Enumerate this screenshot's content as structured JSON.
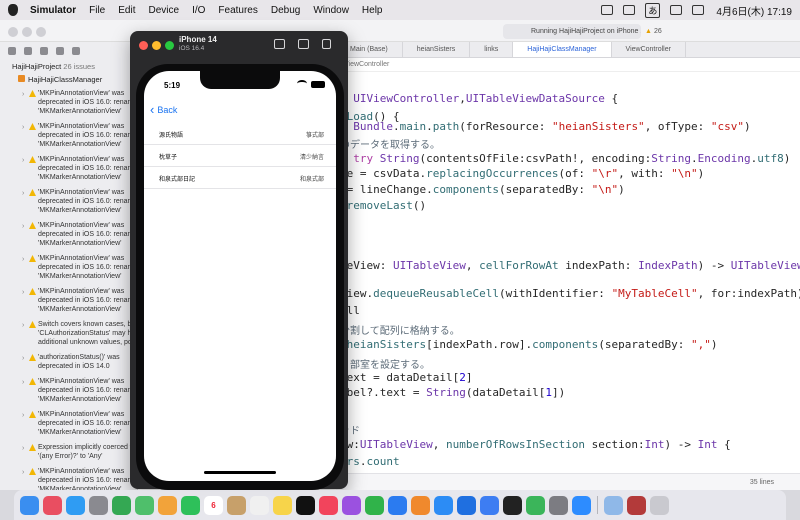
{
  "menubar": {
    "items": [
      "Simulator",
      "File",
      "Edit",
      "Device",
      "I/O",
      "Features",
      "Debug",
      "Window",
      "Help"
    ],
    "input_badge": "あ",
    "clock": "4月6日(木) 17:19"
  },
  "xcode": {
    "tabs": [
      {
        "label": "Main (Base)",
        "active": false
      },
      {
        "label": "heianSisters",
        "active": false
      },
      {
        "label": "links",
        "active": false
      },
      {
        "label": "HajiHajiClassManager",
        "active": true
      },
      {
        "label": "ViewController",
        "active": false
      }
    ],
    "breadcrumb": "ViewController",
    "run_status": "Running HajiHajiProject on iPhone 14",
    "warning_count": "26",
    "status_line": "35 lines",
    "navigator": {
      "project": "HajiHajiProject",
      "project_count": "26 issues",
      "file": "HajiHajiClassManager",
      "issues": [
        "'MKPinAnnotationView' was\ndeprecated in iOS 16.0: renam\n'MKMarkerAnnotationView'",
        "'MKPinAnnotationView' was\ndeprecated in iOS 16.0: renam\n'MKMarkerAnnotationView'",
        "'MKPinAnnotationView' was\ndeprecated in iOS 16.0: renam\n'MKMarkerAnnotationView'",
        "'MKPinAnnotationView' was\ndeprecated in iOS 16.0: renam\n'MKMarkerAnnotationView'",
        "'MKPinAnnotationView' was\ndeprecated in iOS 16.0: renam\n'MKMarkerAnnotationView'",
        "'MKPinAnnotationView' was\ndeprecated in iOS 16.0: renam\n'MKMarkerAnnotationView'",
        "'MKPinAnnotationView' was\ndeprecated in iOS 16.0: renam\n'MKMarkerAnnotationView'",
        "Switch covers known cases, b\n'CLAuthorizationStatus' may h\nadditional unknown values, po",
        "'authorizationStatus()' was\ndeprecated in iOS 14.0",
        "'MKPinAnnotationView' was\ndeprecated in iOS 16.0: renam\n'MKMarkerAnnotationView'",
        "'MKPinAnnotationView' was\ndeprecated in iOS 16.0: renam\n'MKMarkerAnnotationView'",
        "Expression implicitly coerced f\n'(any Error)?' to 'Any'",
        "'MKPinAnnotationView' was\ndeprecated in iOS 16.0: renam\n'MKMarkerAnnotationView'",
        "'MKPinAnnotationView' was\ndeprecated in iOS 16.0: renam\n'MKMarkerAnnotationView'"
      ]
    },
    "code_lines": [
      [
        [
          "",
          ": "
        ],
        [
          "ty",
          "UIViewController"
        ],
        [
          "",
          ","
        ],
        [
          "ty",
          "UITableViewDataSource"
        ],
        [
          "",
          " {"
        ]
      ],
      [
        [
          "fn",
          "dLoad"
        ],
        [
          "",
          "() {"
        ]
      ],
      [
        [
          "",
          "= "
        ],
        [
          "ty",
          "Bundle"
        ],
        [
          "",
          "."
        ],
        [
          "fn",
          "main"
        ],
        [
          "",
          "."
        ],
        [
          "fn",
          "path"
        ],
        [
          "",
          "(forResource: "
        ],
        [
          "st",
          "\"heianSisters\""
        ],
        [
          "",
          ", ofType: "
        ],
        [
          "st",
          "\"csv\""
        ],
        [
          "",
          ")"
        ]
      ],
      [
        [
          "cm",
          "のデータを取得する。"
        ]
      ],
      [
        [
          "",
          "= "
        ],
        [
          "kw",
          "try"
        ],
        [
          "",
          " "
        ],
        [
          "ty",
          "String"
        ],
        [
          "",
          "(contentsOfFile:csvPath!, encoding:"
        ],
        [
          "ty",
          "String"
        ],
        [
          "",
          "."
        ],
        [
          "ty",
          "Encoding"
        ],
        [
          "",
          "."
        ],
        [
          "fn",
          "utf8"
        ],
        [
          "",
          ")"
        ]
      ],
      [
        [
          "",
          "ge = csvData."
        ],
        [
          "fn",
          "replacingOccurrences"
        ],
        [
          "",
          "(of: "
        ],
        [
          "st",
          "\"\\r\""
        ],
        [
          "",
          ", with: "
        ],
        [
          "st",
          "\"\\n\""
        ],
        [
          "",
          ")"
        ]
      ],
      [
        [
          "",
          " = lineChange."
        ],
        [
          "fn",
          "components"
        ],
        [
          "",
          "(separatedBy: "
        ],
        [
          "st",
          "\"\\n\""
        ],
        [
          "",
          ")"
        ]
      ],
      [
        [
          "",
          "."
        ],
        [
          "fn",
          "removeLast"
        ],
        [
          "",
          "()"
        ]
      ],
      [
        [
          "",
          "leView: "
        ],
        [
          "ty",
          "UITableView"
        ],
        [
          "",
          ", "
        ],
        [
          "fn",
          "cellForRowAt"
        ],
        [
          "",
          " indexPath: "
        ],
        [
          "ty",
          "IndexPath"
        ],
        [
          "",
          ") -> "
        ],
        [
          "ty",
          "UITableViewCell"
        ],
        [
          "",
          " {"
        ]
      ],
      [
        [
          "",
          "View."
        ],
        [
          "fn",
          "dequeueReusableCell"
        ],
        [
          "",
          "(withIdentifier: "
        ],
        [
          "st",
          "\"MyTableCell\""
        ],
        [
          "",
          ", for:indexPath) "
        ],
        [
          "kw",
          "as"
        ]
      ],
      [
        [
          "",
          "ell"
        ]
      ],
      [
        [
          "cm",
          "分割して配列に格納する。"
        ]
      ],
      [
        [
          "",
          " "
        ],
        [
          "fn",
          "heianSisters"
        ],
        [
          "",
          "[indexPath.row]."
        ],
        [
          "fn",
          "components"
        ],
        [
          "",
          "(separatedBy: "
        ],
        [
          "st",
          "\",\""
        ],
        [
          "",
          ")"
        ]
      ],
      [
        [
          "cm",
          "、部室を設定する。"
        ]
      ],
      [
        [
          "",
          "text = dataDetail["
        ],
        [
          "nm",
          "2"
        ],
        [
          "",
          "]"
        ]
      ],
      [
        [
          "",
          "abel?.text = "
        ],
        [
          "ty",
          "String"
        ],
        [
          "",
          "(dataDetail["
        ],
        [
          "nm",
          "1"
        ],
        [
          "",
          "])"
        ]
      ],
      [
        [
          "cm",
          "ッド"
        ]
      ],
      [
        [
          "",
          "ew:"
        ],
        [
          "ty",
          "UITableView"
        ],
        [
          "",
          ", "
        ],
        [
          "fn",
          "numberOfRowsInSection"
        ],
        [
          "",
          " section:"
        ],
        [
          "ty",
          "Int"
        ],
        [
          "",
          ") -> "
        ],
        [
          "ty",
          "Int"
        ],
        [
          "",
          " {"
        ]
      ],
      [
        [
          "fn",
          "ers"
        ],
        [
          "",
          "."
        ],
        [
          "fn",
          "count"
        ]
      ]
    ]
  },
  "simulator": {
    "device_name": "iPhone 14",
    "os": "iOS 16.4",
    "toolbar": [
      "home-icon",
      "screenshot-icon",
      "rotate-icon"
    ]
  },
  "phone": {
    "time": "5:19",
    "back_label": "Back",
    "rows": [
      {
        "title": "源氏物語",
        "detail": "箏式部"
      },
      {
        "title": "枕草子",
        "detail": "清少納言"
      },
      {
        "title": "和泉式部日記",
        "detail": "和泉式部"
      }
    ]
  },
  "dock": {
    "apps": [
      {
        "name": "finder-icon",
        "color": "#3a8ef0"
      },
      {
        "name": "launchpad-icon",
        "color": "#e94e61"
      },
      {
        "name": "safari-icon",
        "color": "#2f9cf3"
      },
      {
        "name": "settings-icon",
        "color": "#8a8a90"
      },
      {
        "name": "chrome-icon",
        "color": "#34a853"
      },
      {
        "name": "maps-icon",
        "color": "#4fbf6b"
      },
      {
        "name": "photos-icon",
        "color": "#f2a33a"
      },
      {
        "name": "facetime-icon",
        "color": "#2ec05a"
      },
      {
        "name": "calendar-icon",
        "color": "#ffffff",
        "text": "6"
      },
      {
        "name": "contacts-icon",
        "color": "#c7a06a"
      },
      {
        "name": "reminders-icon",
        "color": "#f0f0f0"
      },
      {
        "name": "notes-icon",
        "color": "#f7d44a"
      },
      {
        "name": "appletv-icon",
        "color": "#111111"
      },
      {
        "name": "music-icon",
        "color": "#f2445c"
      },
      {
        "name": "podcasts-icon",
        "color": "#9b51e0"
      },
      {
        "name": "numbers-icon",
        "color": "#30b34a"
      },
      {
        "name": "keynote-icon",
        "color": "#2b7bf0"
      },
      {
        "name": "pages-icon",
        "color": "#f0892d"
      },
      {
        "name": "appstore-icon",
        "color": "#2c8cf5"
      },
      {
        "name": "xcode-icon",
        "color": "#1f6fe0"
      },
      {
        "name": "simulator-icon",
        "color": "#3d7df2"
      },
      {
        "name": "terminal-icon",
        "color": "#222222"
      },
      {
        "name": "activity-monitor-icon",
        "color": "#3bb55a"
      },
      {
        "name": "system-settings-icon",
        "color": "#7c7c82"
      },
      {
        "name": "zoom-icon",
        "color": "#2d8cff"
      },
      {
        "name": "preview-icon",
        "color": "#8fb8e8"
      },
      {
        "name": "dictionary-icon",
        "color": "#b33a3a"
      },
      {
        "name": "trash-icon",
        "color": "#c9c9cf"
      }
    ]
  }
}
